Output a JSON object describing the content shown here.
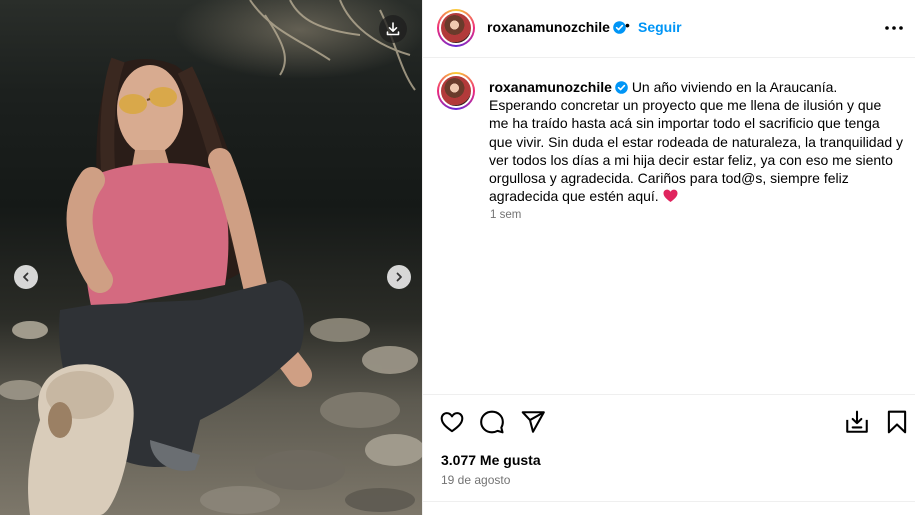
{
  "post": {
    "username": "roxanamunozchile",
    "follow_label": "Seguir",
    "separator": "•",
    "caption_username": "roxanamunozchile",
    "caption_text": "Un año viviendo en la Araucanía.\nEsperando concretar un proyecto que me llena de ilusión y que me ha traído hasta acá sin importar todo el sacrificio que tenga que vivir. Sin duda el estar rodeada de naturaleza, la tranquilidad y ver todos los días a mi hija decir estar feliz, ya con eso me siento orgullosa y agradecida. Cariños para tod@s, siempre feliz agradecida que estén aquí.",
    "caption_emoji": "heart-emoji",
    "caption_time": "1 sem",
    "likes": "3.077 Me gusta",
    "date": "19 de agosto"
  },
  "icons": {
    "verified": "verified-badge-icon",
    "more": "more-options-icon",
    "download": "download-icon",
    "prev": "chevron-left-icon",
    "next": "chevron-right-icon",
    "like": "heart-icon",
    "comment": "comment-icon",
    "share": "send-icon",
    "save_to": "save-to-collection-icon",
    "bookmark": "bookmark-icon"
  },
  "colors": {
    "accent": "#0095f6",
    "verified": "#0095f6",
    "muted_text": "#737373",
    "heart_emoji": "#e0245e"
  }
}
